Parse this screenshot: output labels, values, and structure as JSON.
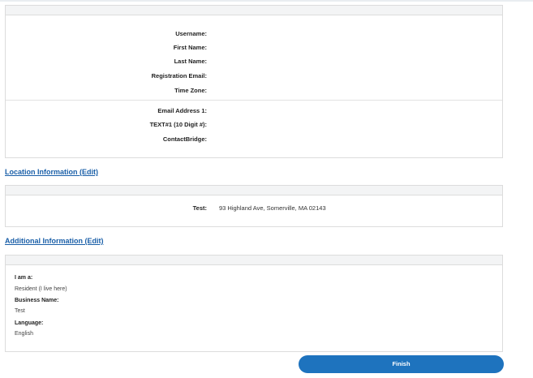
{
  "account_panel": {
    "fields": [
      {
        "label": "Username:",
        "value": ""
      },
      {
        "label": "First Name:",
        "value": ""
      },
      {
        "label": "Last Name:",
        "value": ""
      },
      {
        "label": "Registration Email:",
        "value": ""
      },
      {
        "label": "Time Zone:",
        "value": ""
      }
    ],
    "contact_fields": [
      {
        "label": "Email Address 1:",
        "value": ""
      },
      {
        "label": "TEXT#1 (10 Digit #):",
        "value": ""
      },
      {
        "label": "ContactBridge:",
        "value": ""
      }
    ]
  },
  "location_section": {
    "link_text": "Location Information (Edit)",
    "rows": [
      {
        "label": "Test:",
        "value": "93 Highland Ave, Somerville, MA 02143"
      }
    ]
  },
  "additional_section": {
    "link_text": "Additional Information (Edit)",
    "items": [
      {
        "label": "I am a:",
        "value": "Resident (I live here)"
      },
      {
        "label": "Business Name:",
        "value": "Test"
      },
      {
        "label": "Language:",
        "value": "English"
      }
    ]
  },
  "finish_button": {
    "label": "Finish"
  },
  "colors": {
    "accent": "#1e73be",
    "link": "#1a5fa8"
  }
}
